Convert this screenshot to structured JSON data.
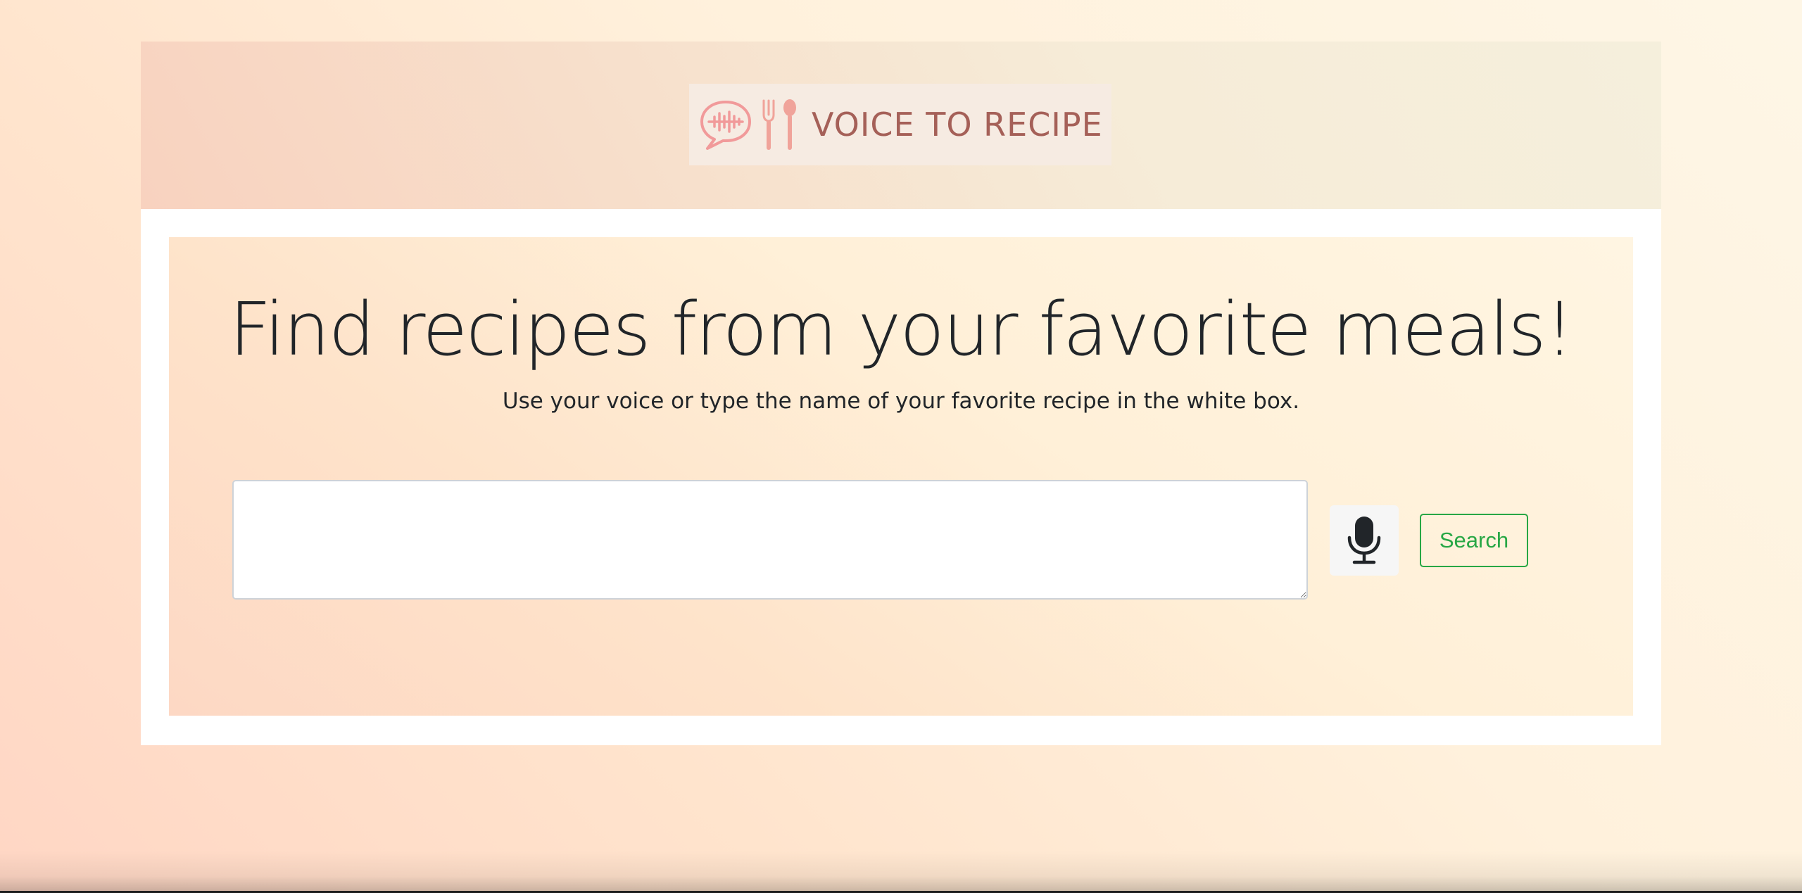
{
  "header": {
    "logo_text": "VOICE TO RECIPE",
    "logo_icons": [
      "speech-bubble-soundwave-icon",
      "fork-icon",
      "spoon-icon"
    ]
  },
  "main": {
    "title": "Find recipes from your favorite meals!",
    "subtitle": "Use your voice or type the name of your favorite recipe in the white box.",
    "search_input": {
      "value": "",
      "placeholder": ""
    },
    "mic_button": {
      "icon": "microphone-icon"
    },
    "search_button": {
      "label": "Search"
    }
  },
  "colors": {
    "title_text": "#212529",
    "logo_text": "#a56058",
    "logo_icon": "#f19a9a",
    "search_button": "#28a745",
    "mic_button_bg": "#f6f6f6"
  }
}
